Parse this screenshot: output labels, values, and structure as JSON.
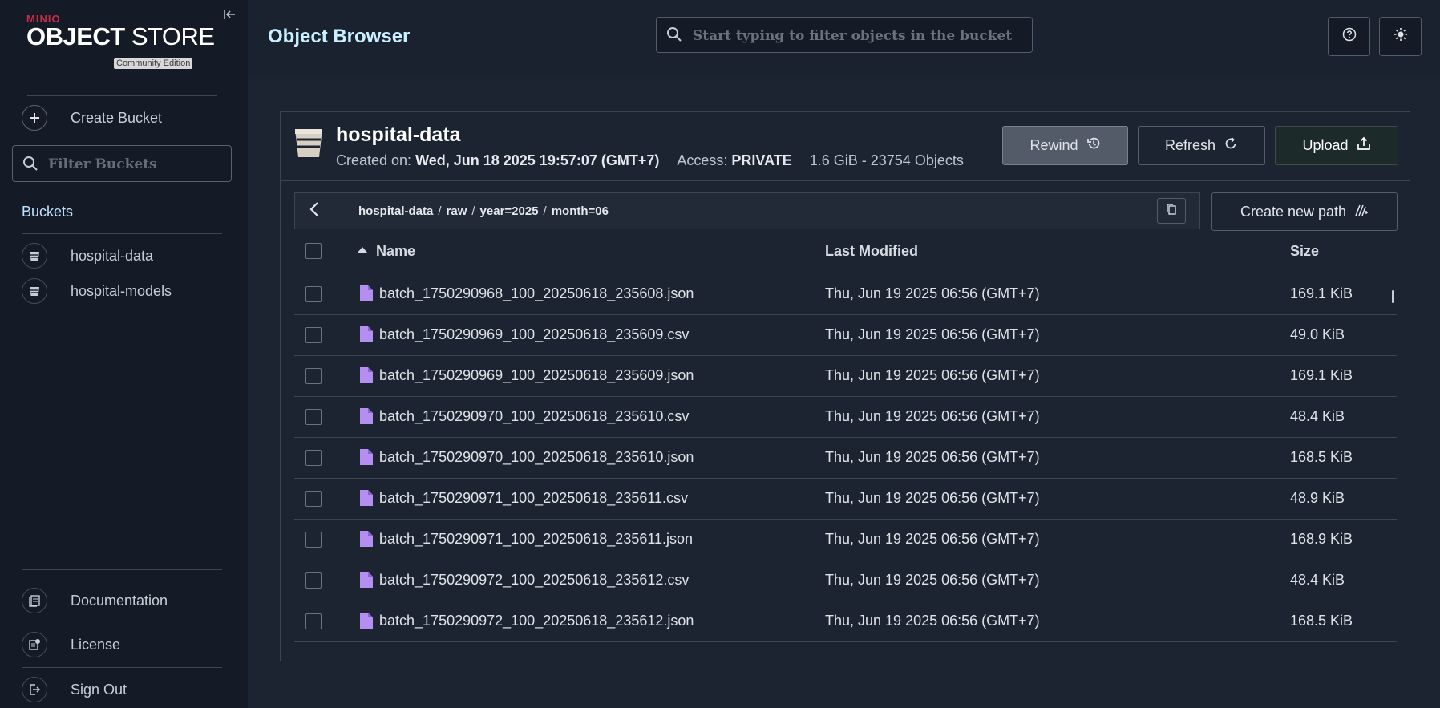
{
  "brand": {
    "minio": "MINIO",
    "product_bold": "OBJECT",
    "product_rest": " STORE",
    "edition": "Community Edition"
  },
  "sidebar": {
    "create_bucket": "Create Bucket",
    "filter_placeholder": "Filter Buckets",
    "buckets_heading": "Buckets",
    "buckets": [
      {
        "label": "hospital-data"
      },
      {
        "label": "hospital-models"
      }
    ],
    "documentation": "Documentation",
    "license": "License",
    "sign_out": "Sign Out"
  },
  "header": {
    "title": "Object Browser",
    "search_placeholder": "Start typing to filter objects in the bucket"
  },
  "bucket": {
    "name": "hospital-data",
    "created_label": "Created on: ",
    "created_value": "Wed, Jun 18 2025 19:57:07 (GMT+7)",
    "access_label": "Access: ",
    "access_value": "PRIVATE",
    "usage": "1.6 GiB - 23754 Objects",
    "rewind": "Rewind",
    "refresh": "Refresh",
    "upload": "Upload"
  },
  "path": {
    "crumbs": [
      "hospital-data",
      "raw",
      "year=2025",
      "month=06"
    ],
    "create_new_path": "Create new path"
  },
  "table": {
    "columns": {
      "name": "Name",
      "modified": "Last Modified",
      "size": "Size"
    },
    "rows": [
      {
        "name": "batch_1750290968_100_20250618_235608.json",
        "modified": "Thu, Jun 19 2025 06:56 (GMT+7)",
        "size": "169.1 KiB"
      },
      {
        "name": "batch_1750290969_100_20250618_235609.csv",
        "modified": "Thu, Jun 19 2025 06:56 (GMT+7)",
        "size": "49.0 KiB"
      },
      {
        "name": "batch_1750290969_100_20250618_235609.json",
        "modified": "Thu, Jun 19 2025 06:56 (GMT+7)",
        "size": "169.1 KiB"
      },
      {
        "name": "batch_1750290970_100_20250618_235610.csv",
        "modified": "Thu, Jun 19 2025 06:56 (GMT+7)",
        "size": "48.4 KiB"
      },
      {
        "name": "batch_1750290970_100_20250618_235610.json",
        "modified": "Thu, Jun 19 2025 06:56 (GMT+7)",
        "size": "168.5 KiB"
      },
      {
        "name": "batch_1750290971_100_20250618_235611.csv",
        "modified": "Thu, Jun 19 2025 06:56 (GMT+7)",
        "size": "48.9 KiB"
      },
      {
        "name": "batch_1750290971_100_20250618_235611.json",
        "modified": "Thu, Jun 19 2025 06:56 (GMT+7)",
        "size": "168.9 KiB"
      },
      {
        "name": "batch_1750290972_100_20250618_235612.csv",
        "modified": "Thu, Jun 19 2025 06:56 (GMT+7)",
        "size": "48.4 KiB"
      },
      {
        "name": "batch_1750290972_100_20250618_235612.json",
        "modified": "Thu, Jun 19 2025 06:56 (GMT+7)",
        "size": "168.5 KiB"
      }
    ]
  },
  "colors": {
    "accent_title": "#c9f0ff",
    "brand_red": "#c72c48",
    "file_icon": "#b48ef0",
    "buckets_heading": "#bfe3ff"
  }
}
